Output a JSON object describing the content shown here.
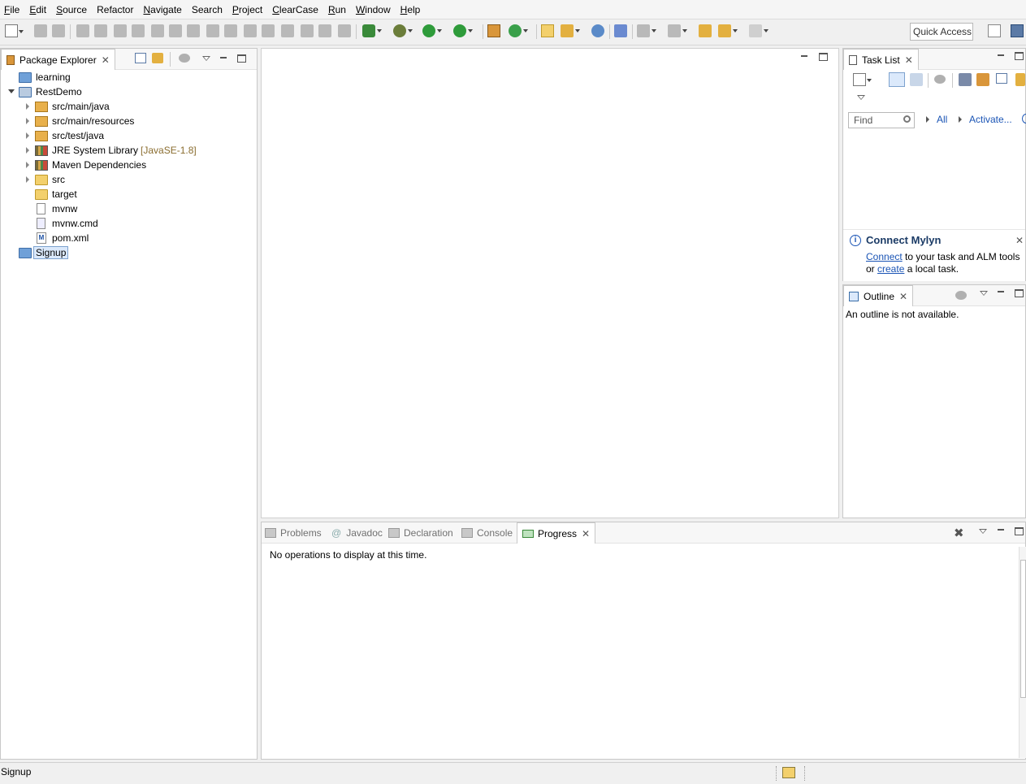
{
  "menu": [
    {
      "label": "File",
      "u": "F",
      "rest": "ile"
    },
    {
      "label": "Edit",
      "u": "E",
      "rest": "dit"
    },
    {
      "label": "Source",
      "u": "S",
      "rest": "ource"
    },
    {
      "label": "Refactor",
      "u": "",
      "rest": "Refactor"
    },
    {
      "label": "Navigate",
      "u": "N",
      "rest": "avigate"
    },
    {
      "label": "Search",
      "u": "",
      "rest": "Search"
    },
    {
      "label": "Project",
      "u": "P",
      "rest": "roject"
    },
    {
      "label": "ClearCase",
      "u": "C",
      "rest": "learCase"
    },
    {
      "label": "Run",
      "u": "R",
      "rest": "un"
    },
    {
      "label": "Window",
      "u": "W",
      "rest": "indow"
    },
    {
      "label": "Help",
      "u": "H",
      "rest": "elp"
    }
  ],
  "toolbar": {
    "quick_access": "Quick Access"
  },
  "package_explorer": {
    "title": "Package Explorer",
    "tree": {
      "learning": "learning",
      "restdemo": "RestDemo",
      "src_main_java": "src/main/java",
      "src_main_resources": "src/main/resources",
      "src_test_java": "src/test/java",
      "jre": "JRE System Library",
      "jre_version": "[JavaSE-1.8]",
      "maven": "Maven Dependencies",
      "src": "src",
      "target": "target",
      "mvnw": "mvnw",
      "mvnw_cmd": "mvnw.cmd",
      "pom": "pom.xml",
      "signup": "Signup"
    }
  },
  "task_list": {
    "title": "Task List",
    "find_placeholder": "Find",
    "all_label": "All",
    "activate_label": "Activate...",
    "mylyn": {
      "title": "Connect Mylyn",
      "connect_link": "Connect",
      "text1": " to your task and ALM tools",
      "or": "or ",
      "create_link": "create",
      "text2": " a local task."
    }
  },
  "outline": {
    "title": "Outline",
    "message": "An outline is not available."
  },
  "bottom_panel": {
    "tabs": {
      "problems": "Problems",
      "javadoc": "Javadoc",
      "declaration": "Declaration",
      "console": "Console",
      "progress": "Progress"
    },
    "message": "No operations to display at this time."
  },
  "status": {
    "text": "Signup"
  }
}
